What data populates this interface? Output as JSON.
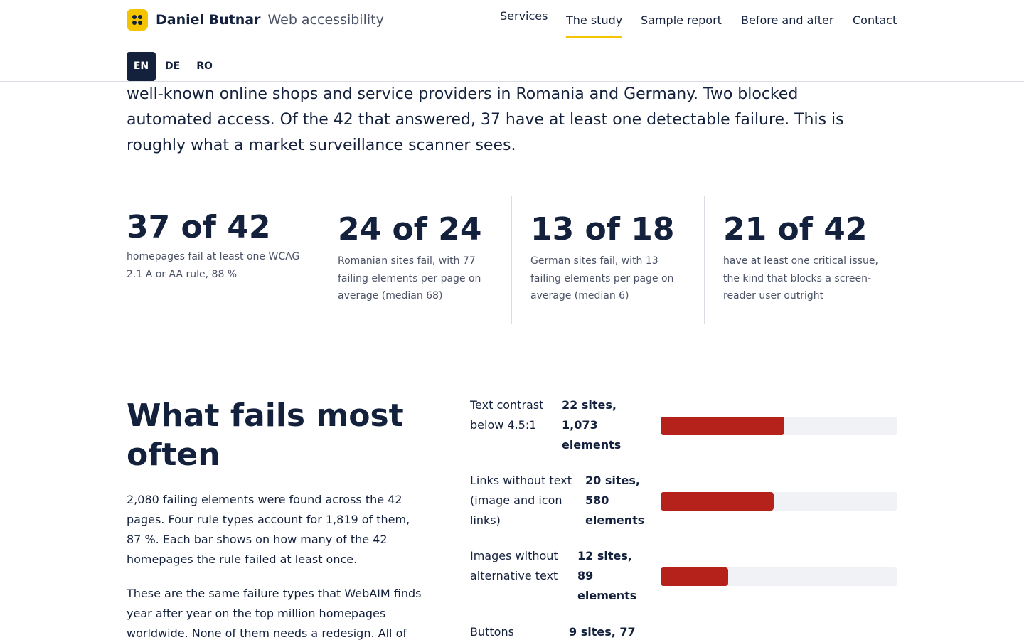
{
  "brand": {
    "name": "Daniel Butnar",
    "subtitle": "Web accessibility"
  },
  "nav": {
    "items": [
      {
        "label": "Services"
      },
      {
        "label": "The study",
        "active": true
      },
      {
        "label": "Sample report"
      },
      {
        "label": "Before and after"
      },
      {
        "label": "Contact"
      }
    ]
  },
  "languages": [
    {
      "code": "EN",
      "active": true
    },
    {
      "code": "DE"
    },
    {
      "code": "RO"
    }
  ],
  "intro": {
    "text": "well-known online shops and service providers in Romania and Germany. Two blocked automated access. Of the 42 that answered, 37 have at least one detectable failure. This is roughly what a market surveillance scanner sees."
  },
  "stats": [
    {
      "value": "37 of 42",
      "description": "homepages fail at least one WCAG 2.1 A or AA rule, 88 %"
    },
    {
      "value": "24 of 24",
      "description": "Romanian sites fail, with 77 failing elements per page on average (median 68)"
    },
    {
      "value": "13 of 18",
      "description": "German sites fail, with 13 failing elements per page on average (median 6)"
    },
    {
      "value": "21 of 42",
      "description": "have at least one critical issue, the kind that blocks a screen-reader user outright"
    }
  ],
  "fails": {
    "title": "What fails most often",
    "paragraph1": "2,080 failing elements were found across the 42 pages. Four rule types account for 1,819 of them, 87 %. Each bar shows on how many of the 42 homepages the rule failed at least once.",
    "paragraph2": "These are the same failure types that WebAIM finds year after year on the top million homepages worldwide. None of them needs a redesign. All of",
    "total_sites": 42,
    "bars": [
      {
        "label": "Text contrast below 4.5:1",
        "count": "22 sites, 1,073 elements",
        "sites": 22
      },
      {
        "label": "Links without text (image and icon links)",
        "count": "20 sites, 580 elements",
        "sites": 20
      },
      {
        "label": "Images without alternative text",
        "count": "12 sites, 89 elements",
        "sites": 12
      },
      {
        "label": "Buttons",
        "count": "9 sites, 77",
        "sites": 9
      }
    ]
  },
  "colors": {
    "accent": "#f5c400",
    "text": "#14213d",
    "bar": "#b5221b",
    "track": "#f1f2f5"
  }
}
